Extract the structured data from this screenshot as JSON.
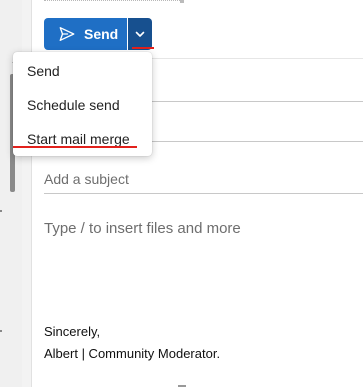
{
  "compose": {
    "send_label": "Send",
    "subject": {
      "placeholder": "Add a subject",
      "value": ""
    },
    "body": {
      "placeholder": "Type / to insert files and more",
      "signature": [
        "Sincerely,",
        "Albert | Community Moderator."
      ]
    }
  },
  "send_menu": {
    "items": [
      {
        "label": "Send"
      },
      {
        "label": "Schedule send"
      },
      {
        "label": "Start mail merge"
      }
    ]
  },
  "colors": {
    "accent": "#1f6fc5",
    "accent_dark": "#17508f",
    "annotation": "#e2211c"
  },
  "icons": {
    "send": "send-icon",
    "dropdown": "chevron-down-icon"
  }
}
